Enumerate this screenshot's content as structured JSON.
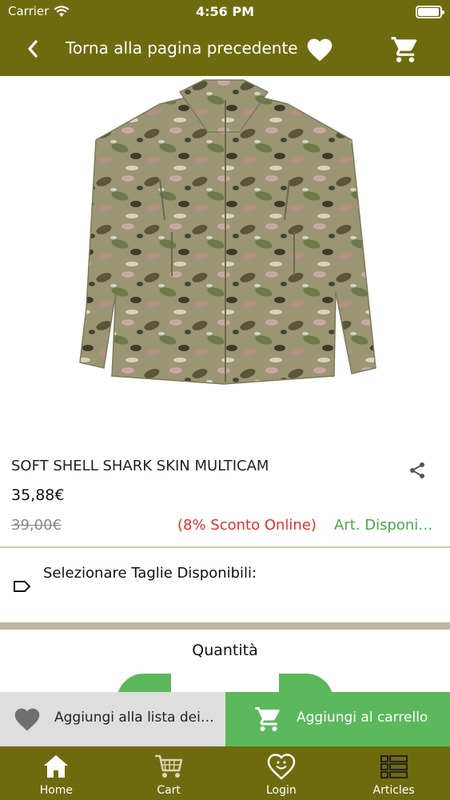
{
  "status_bar": {
    "carrier": "Carrier",
    "time": "4:56 PM"
  },
  "header": {
    "title": "Torna alla pagina precedente"
  },
  "product": {
    "name": "SOFT SHELL SHARK SKIN MULTICAM",
    "price": "35,88€",
    "old_price": "39,00€",
    "discount": "(8% Sconto Online)",
    "availability": "Art. Disponibile"
  },
  "sizes": {
    "label": "Selezionare Taglie Disponibili:"
  },
  "quantity": {
    "label": "Quantità"
  },
  "actions": {
    "wishlist_label": "Aggiungi alla lista dei desideri",
    "add_to_cart_label": "Aggiungi al carrello"
  },
  "bottom_nav": [
    {
      "label": "Home",
      "icon": "home-icon"
    },
    {
      "label": "Cart",
      "icon": "cart-icon"
    },
    {
      "label": "Login",
      "icon": "heart-smile-icon"
    },
    {
      "label": "Articles",
      "icon": "list-icon"
    }
  ],
  "colors": {
    "brand": "#6e6b0f",
    "green": "#5cb85c",
    "discount_red": "#e0312a",
    "available_green": "#4aa84a"
  }
}
